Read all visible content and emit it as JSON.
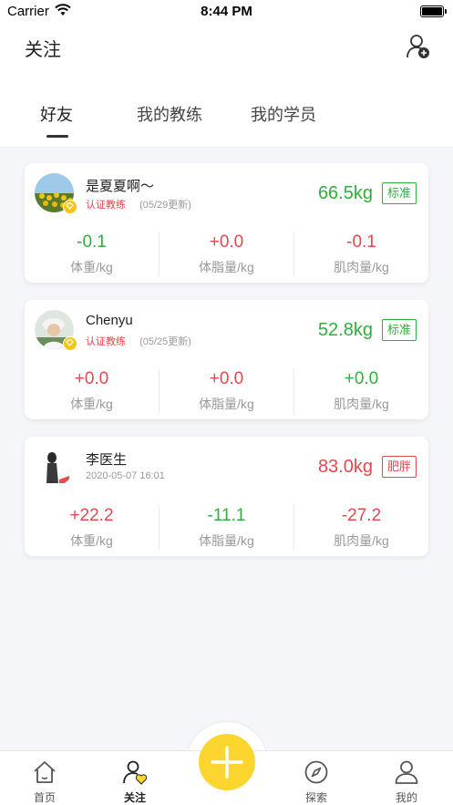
{
  "status": {
    "carrier": "Carrier",
    "time": "8:44 PM"
  },
  "header": {
    "title": "关注"
  },
  "tabs": [
    {
      "label": "好友",
      "active": true
    },
    {
      "label": "我的教练",
      "active": false
    },
    {
      "label": "我的学员",
      "active": false
    }
  ],
  "cards": [
    {
      "name": "是夏夏啊～",
      "cert": "认证教练",
      "updated": "(05/29更新)",
      "weight": "66.5kg",
      "weight_color": "#2eb03a",
      "tag": "标准",
      "stats": [
        {
          "value": "-0.1",
          "label": "体重/kg",
          "color": "green"
        },
        {
          "value": "+0.0",
          "label": "体脂量/kg",
          "color": "red"
        },
        {
          "value": "-0.1",
          "label": "肌肉量/kg",
          "color": "red"
        }
      ]
    },
    {
      "name": "Chenyu",
      "cert": "认证教练",
      "updated": "(05/25更新)",
      "weight": "52.8kg",
      "weight_color": "#2eb03a",
      "tag": "标准",
      "stats": [
        {
          "value": "+0.0",
          "label": "体重/kg",
          "color": "red"
        },
        {
          "value": "+0.0",
          "label": "体脂量/kg",
          "color": "red"
        },
        {
          "value": "+0.0",
          "label": "肌肉量/kg",
          "color": "green"
        }
      ]
    },
    {
      "name": "李医生",
      "date": "2020-05-07 16:01",
      "weight": "83.0kg",
      "weight_color": "#e5484d",
      "tag": "肥胖",
      "stats": [
        {
          "value": "+22.2",
          "label": "体重/kg",
          "color": "red"
        },
        {
          "value": "-11.1",
          "label": "体脂量/kg",
          "color": "green"
        },
        {
          "value": "-27.2",
          "label": "肌肉量/kg",
          "color": "red"
        }
      ]
    }
  ],
  "tabbar": [
    {
      "label": "首页",
      "icon": "home-icon"
    },
    {
      "label": "关注",
      "icon": "follow-icon",
      "active": true
    },
    {
      "label": "探索",
      "icon": "compass-icon"
    },
    {
      "label": "我的",
      "icon": "profile-icon"
    }
  ],
  "fab": {
    "icon": "plus-icon",
    "color": "#fcd62f"
  }
}
